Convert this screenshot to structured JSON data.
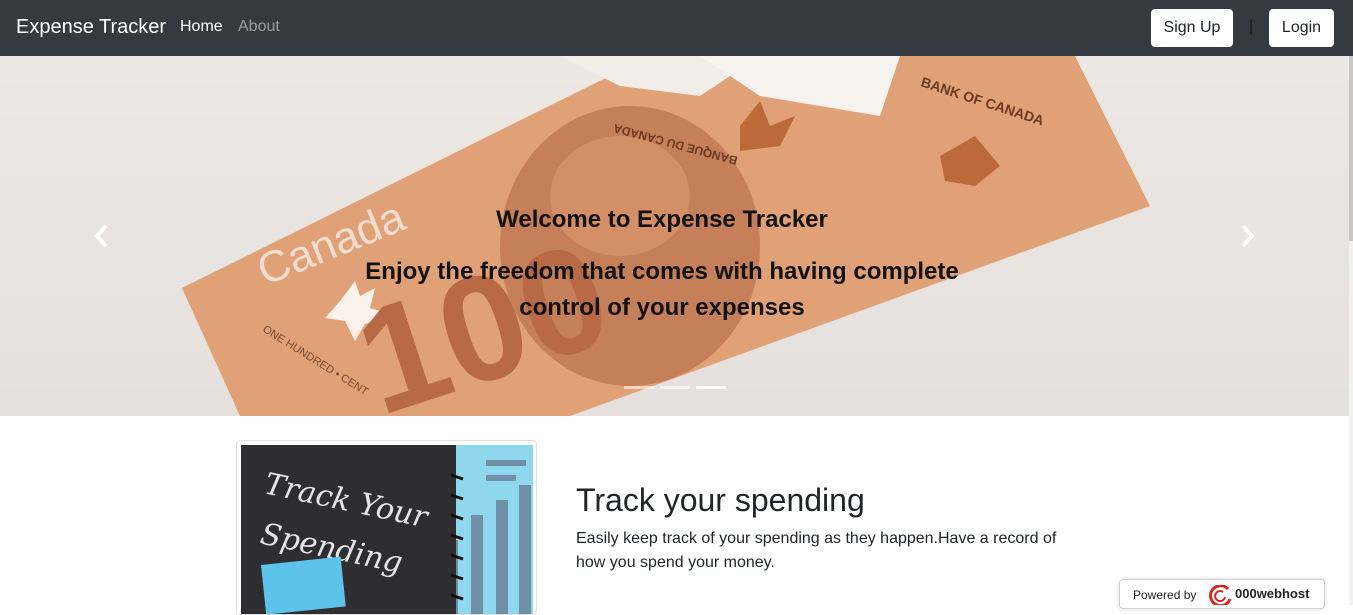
{
  "navbar": {
    "brand": "Expense Tracker",
    "links": [
      {
        "label": "Home",
        "active": true
      },
      {
        "label": "About",
        "active": false
      }
    ],
    "signup_label": "Sign Up",
    "separator": "|",
    "login_label": "Login"
  },
  "hero": {
    "title": "Welcome to Expense Tracker",
    "subtitle": "Enjoy the freedom that comes with having complete control of your expenses",
    "banknote_texts": {
      "country": "Canada",
      "bank_en": "BANK OF CANADA",
      "bank_fr": "BANQUE DU CANADA",
      "denomination": "100",
      "denomination_words": "ONE HUNDRED • CENT"
    },
    "slides_count": 3,
    "active_slide_index": 2,
    "prev_icon": "chevron-left-icon",
    "next_icon": "chevron-right-icon"
  },
  "feature": {
    "image_text_lines": [
      "Track Your",
      "Spending"
    ],
    "title": "Track your spending",
    "text": "Easily keep track of your spending as they happen.Have a record of how you spend your money."
  },
  "badge": {
    "powered_by": "Powered by",
    "host": "000webhost"
  },
  "colors": {
    "navbar_bg": "#343a40",
    "hero_bg": "#ece8e3",
    "note_orange": "#dfa175"
  }
}
